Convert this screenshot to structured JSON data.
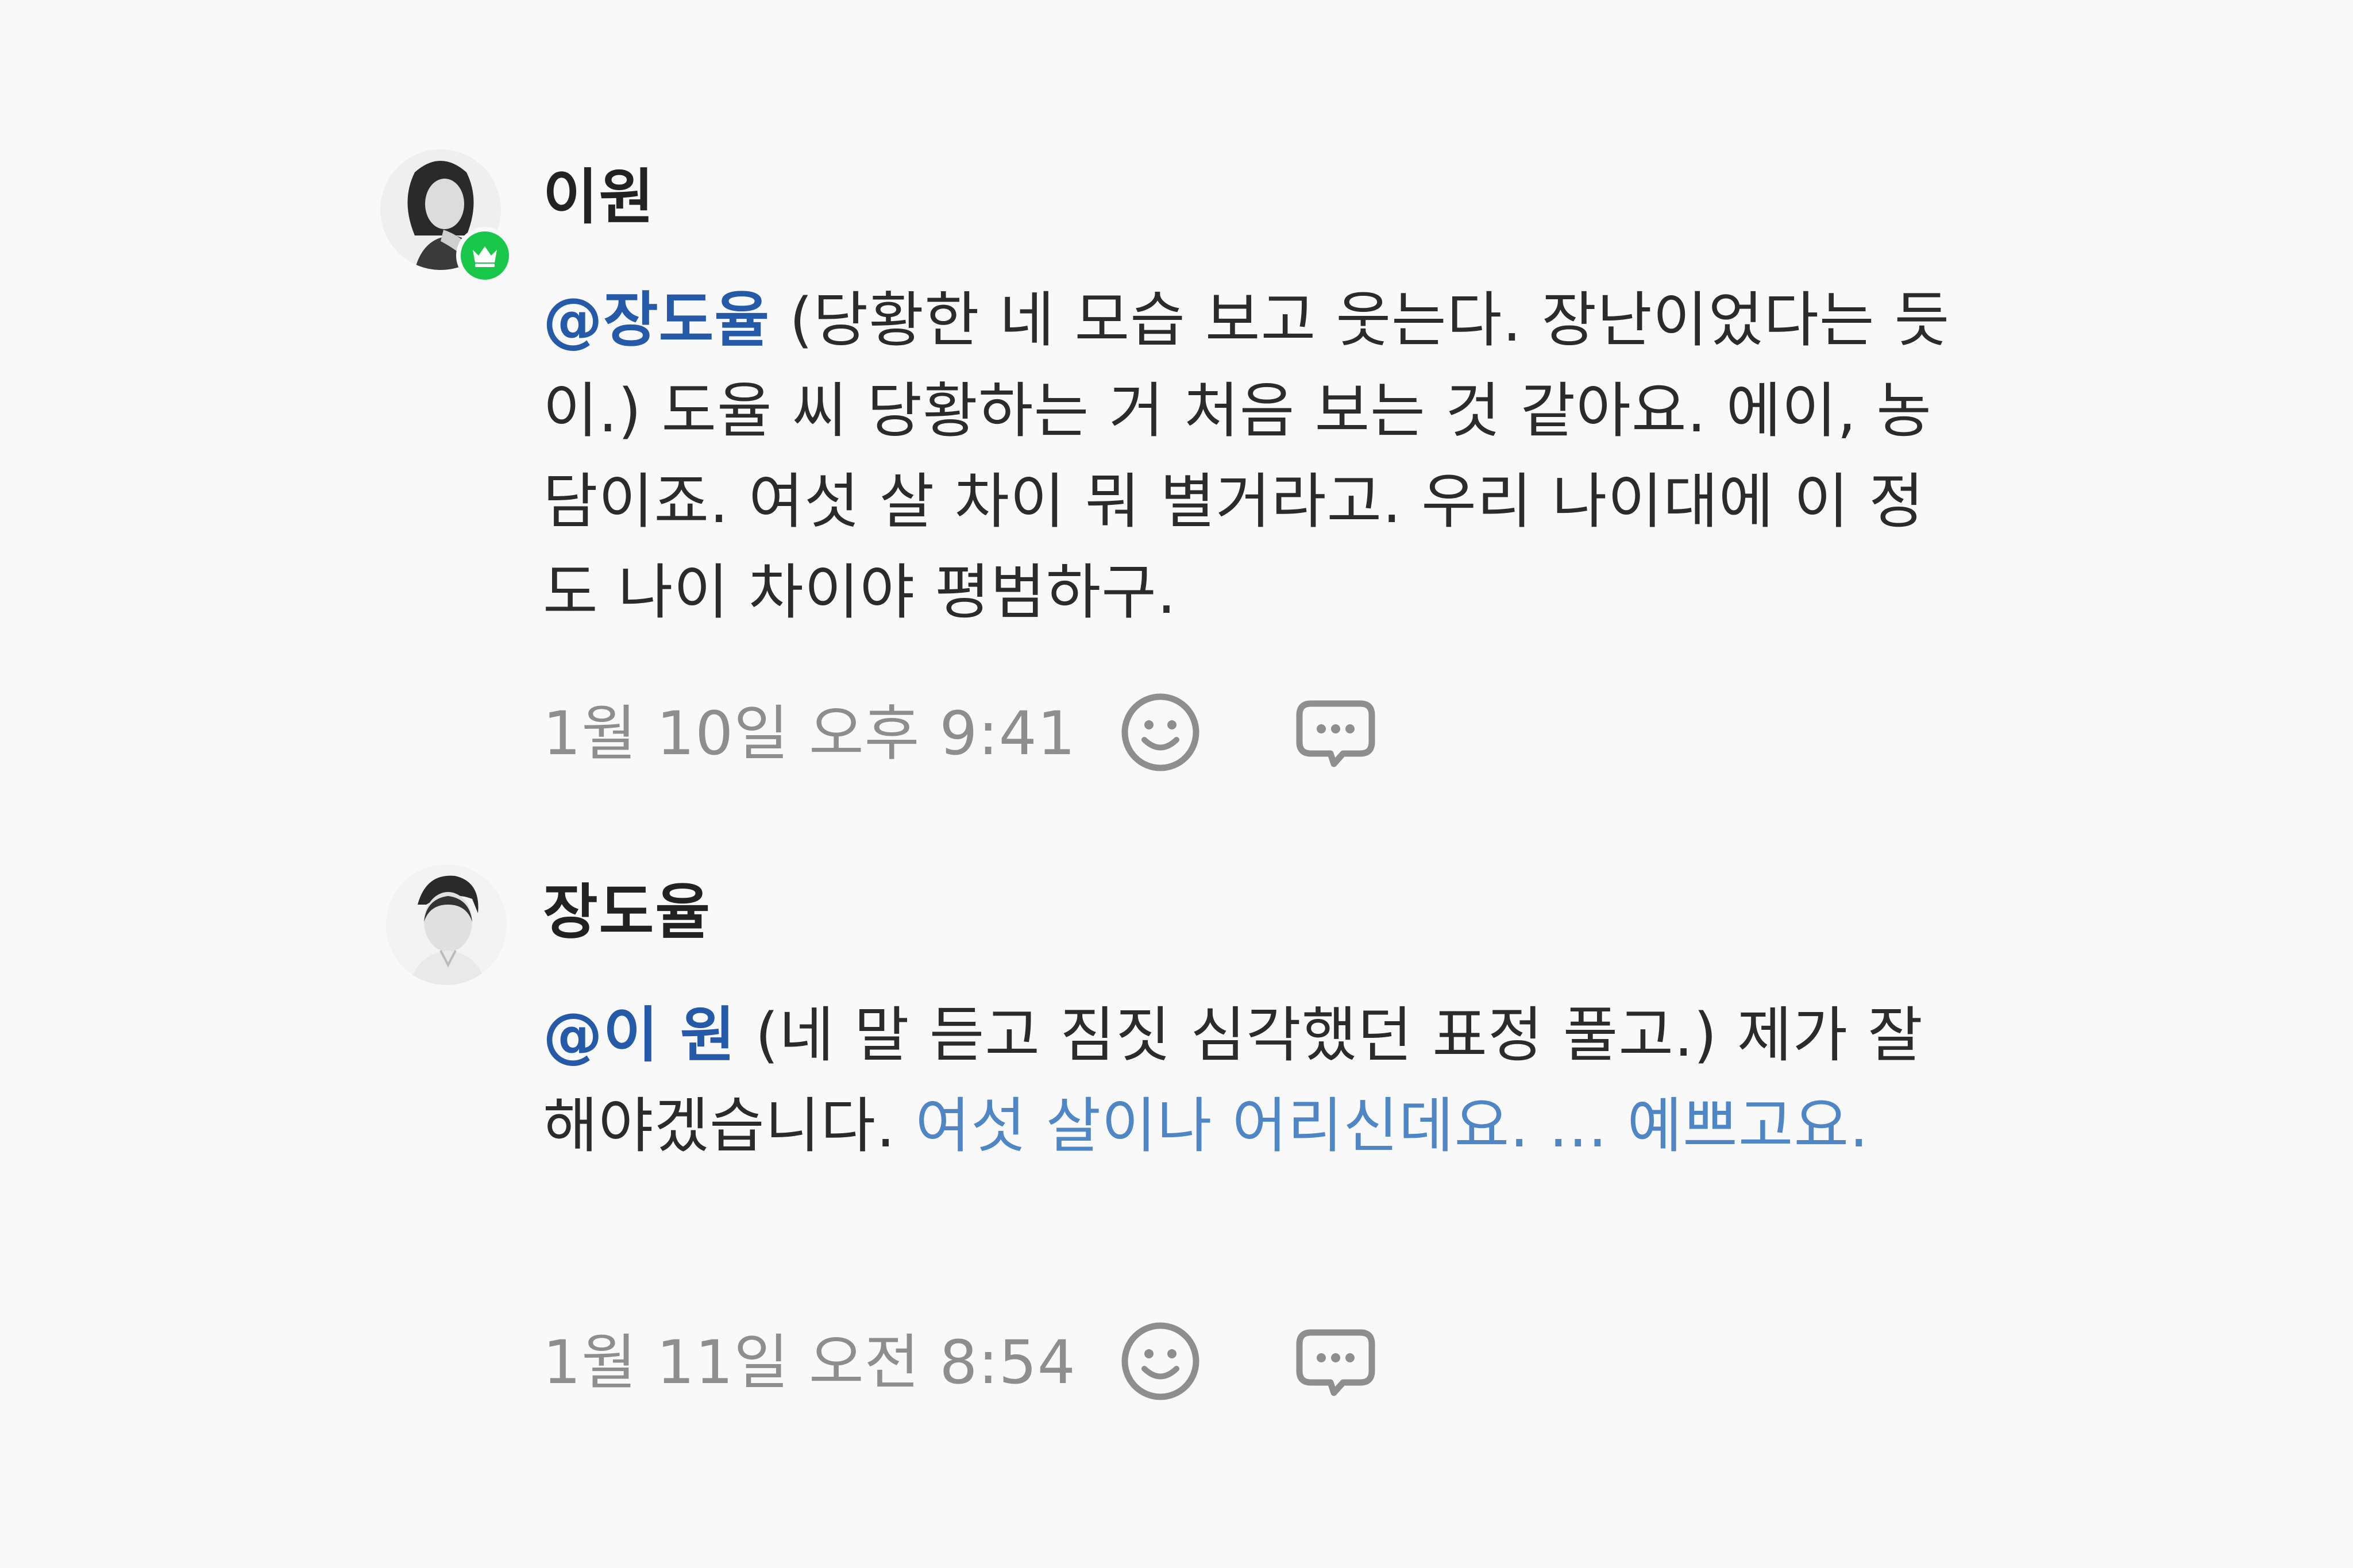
{
  "comments": [
    {
      "author": "이원",
      "mention": "@장도율",
      "text_parts": [
        " (당황한 네 모습 보고 웃는다. 장난이었다는 듯이.) 도율 씨 당황하는 거 처음 보는 것 같아요. 에이, 농담이죠. 여섯 살 차이 뭐 별거라고. 우리 나이대에 이 정도 나이 차이야 평범하구."
      ],
      "timestamp": "1월 10일 오후 9:41",
      "badge": "crown-icon"
    },
    {
      "author": "장도율",
      "mention": "@이 원",
      "text_parts": [
        " (네 말 듣고 짐짓 심각했던 표정 풀고.) 제가 잘해야겠습니다. ",
        "여섯 살이나 어리신데요. ... 예쁘고요."
      ],
      "timestamp": "1월 11일 오전 8:54"
    }
  ],
  "colors": {
    "mention": "#245aa8",
    "link": "#4f86c6",
    "badge": "#19c84a",
    "meta": "#8e8e8e"
  },
  "icons": [
    "smiley-icon",
    "speech-bubble-icon"
  ]
}
